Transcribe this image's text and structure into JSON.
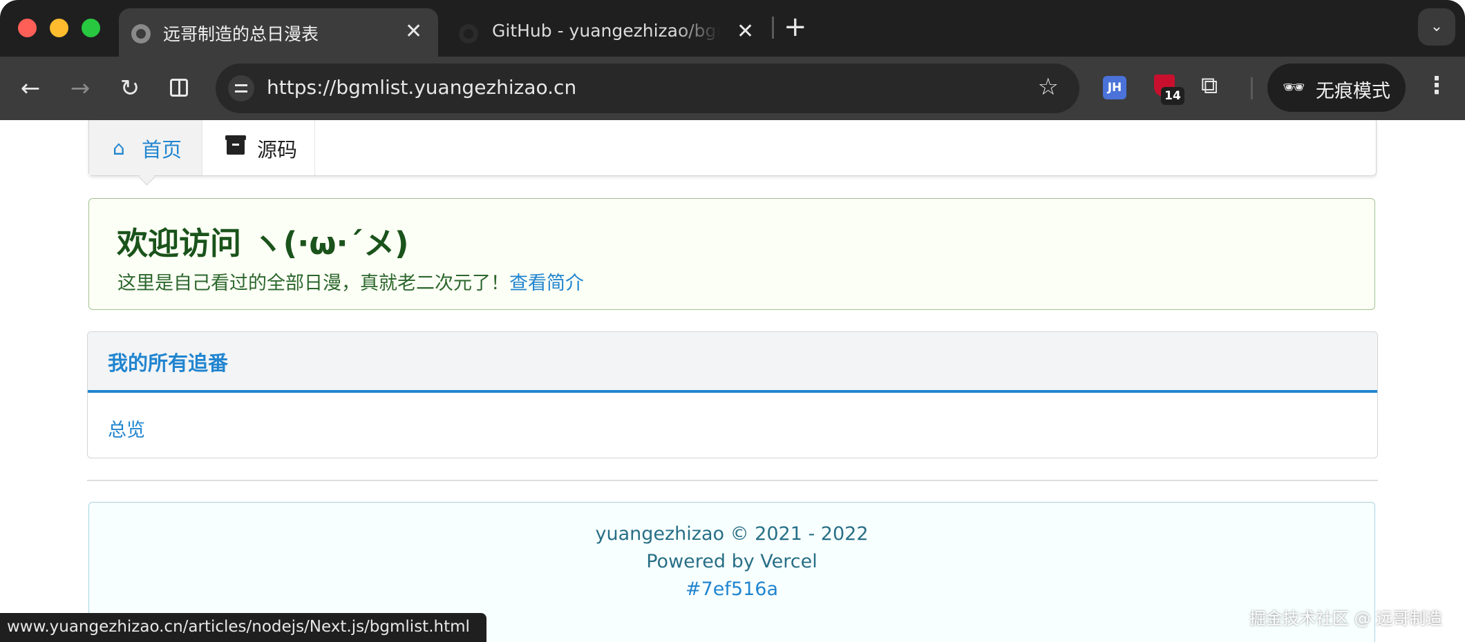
{
  "browser": {
    "tabs": [
      {
        "title": "远哥制造的总日漫表",
        "active": true
      },
      {
        "title": "GitHub - yuangezhizao/bgmlist",
        "active": false
      }
    ],
    "url": "https://bgmlist.yuangezhizao.cn",
    "extensions": {
      "jh_label": "JH",
      "shield_badge": "14"
    },
    "incognito_label": "无痕模式",
    "status_url": "www.yuangezhizao.cn/articles/nodejs/Next.js/bgmlist.html"
  },
  "nav": {
    "home_label": "首页",
    "source_label": "源码"
  },
  "welcome": {
    "title": "欢迎访问 ヽ(·ω·´メ)",
    "text": "这里是自己看过的全部日漫，真就老二次元了！",
    "link": "查看简介"
  },
  "segment": {
    "title": "我的所有追番",
    "link": "总览"
  },
  "footer": {
    "copyright": "yuangezhizao © 2021 - 2022",
    "powered": "Powered by Vercel",
    "commit": "#7ef516a"
  },
  "watermark": "掘金技术社区 @ 远哥制造",
  "colors": {
    "accent": "#2185d0",
    "success_bg": "#fcfff5",
    "success_text": "#2c662d",
    "info_text": "#276f86"
  }
}
